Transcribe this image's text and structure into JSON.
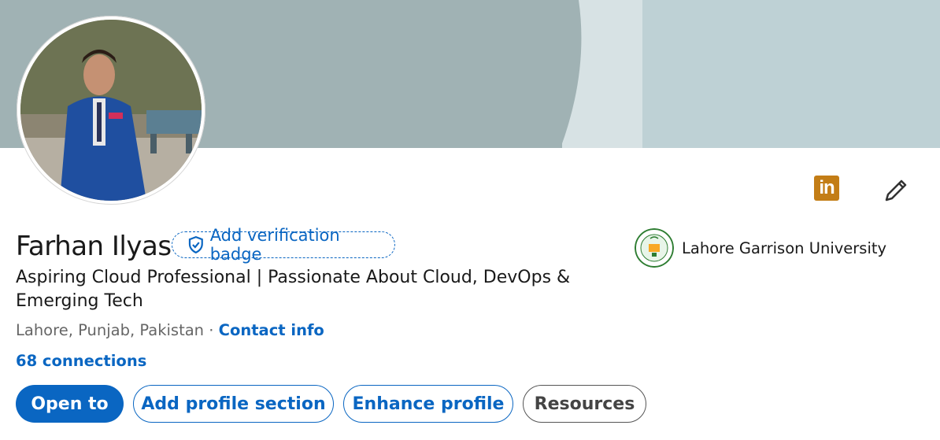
{
  "profile": {
    "name": "Farhan Ilyas",
    "verification_label": "Add verification badge",
    "headline": "Aspiring Cloud Professional | Passionate About Cloud, DevOps & Emerging Tech",
    "location": "Lahore, Punjab, Pakistan",
    "separator": " · ",
    "contact_label": "Contact info",
    "connections_label": "68 connections",
    "education": "Lahore Garrison University",
    "linkedin_logo_text": "in"
  },
  "actions": {
    "open_to": "Open to",
    "add_section": "Add profile section",
    "enhance": "Enhance profile",
    "resources": "Resources"
  },
  "icons": {
    "edit": "pencil-icon",
    "verify": "shield-check-icon",
    "linkedin": "linkedin-logo-icon"
  },
  "colors": {
    "accent": "#0a66c2",
    "banner": "#a0b2b4",
    "linkedin_badge": "#c37d16"
  }
}
